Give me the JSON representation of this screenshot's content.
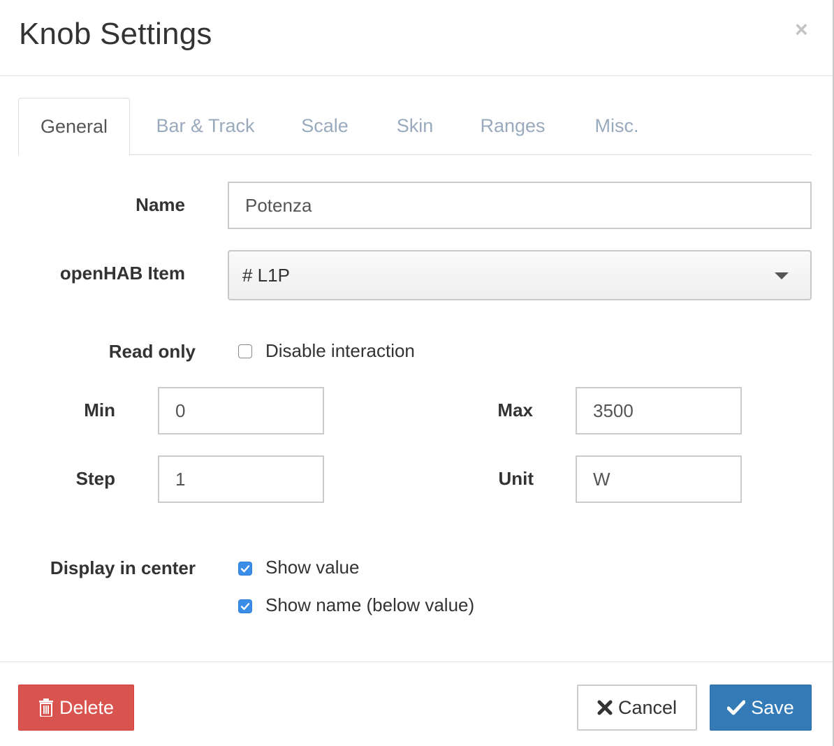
{
  "dialog": {
    "title": "Knob Settings",
    "close_glyph": "×"
  },
  "tabs": [
    {
      "label": "General",
      "active": true
    },
    {
      "label": "Bar & Track",
      "active": false
    },
    {
      "label": "Scale",
      "active": false
    },
    {
      "label": "Skin",
      "active": false
    },
    {
      "label": "Ranges",
      "active": false
    },
    {
      "label": "Misc.",
      "active": false
    }
  ],
  "form": {
    "name": {
      "label": "Name",
      "value": "Potenza"
    },
    "item": {
      "label": "openHAB Item",
      "value": "# L1P"
    },
    "read_only": {
      "label": "Read only",
      "checkbox_label": "Disable interaction",
      "checked": false
    },
    "min": {
      "label": "Min",
      "value": "0"
    },
    "max": {
      "label": "Max",
      "value": "3500"
    },
    "step": {
      "label": "Step",
      "value": "1"
    },
    "unit": {
      "label": "Unit",
      "value": "W"
    },
    "display": {
      "label": "Display in center",
      "show_value": {
        "label": "Show value",
        "checked": true
      },
      "show_name": {
        "label": "Show name (below value)",
        "checked": true
      }
    }
  },
  "footer": {
    "delete_label": "Delete",
    "cancel_label": "Cancel",
    "save_label": "Save"
  },
  "colors": {
    "delete": "#d9534f",
    "save": "#337ab7",
    "checkbox_checked": "#3a8ee8",
    "tab_inactive": "#9aaabd"
  },
  "icons": {
    "close": "close-icon",
    "caret": "chevron-down-icon",
    "delete": "trash-icon",
    "cancel": "x-icon",
    "save": "checkmark-icon"
  }
}
